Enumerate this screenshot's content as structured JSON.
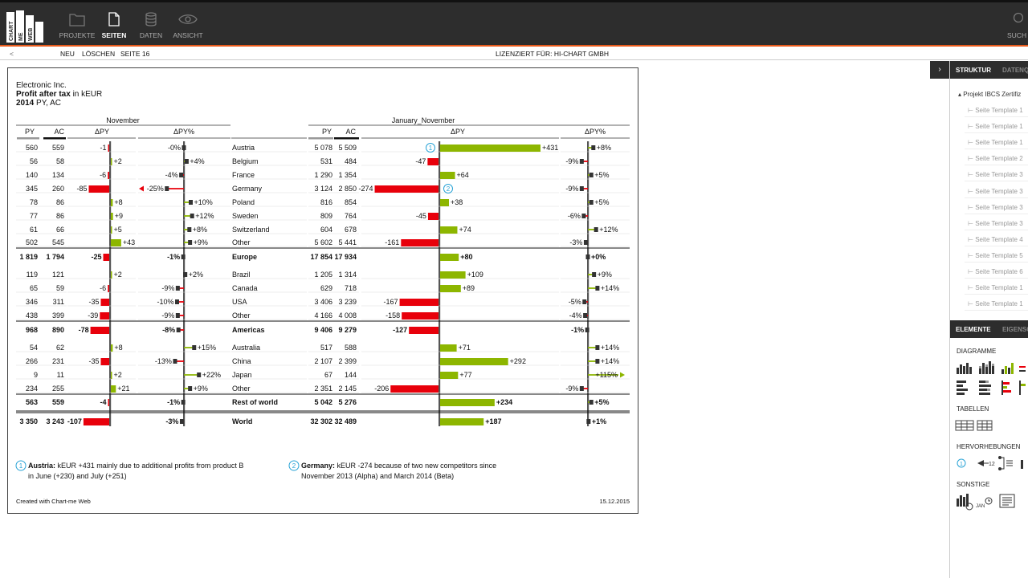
{
  "app": {
    "logo_text": [
      "CHART",
      "ME",
      "WEB"
    ]
  },
  "nav": [
    {
      "label": "PROJEKTE",
      "icon": "folder-icon"
    },
    {
      "label": "SEITEN",
      "icon": "page-icon",
      "active": true
    },
    {
      "label": "DATEN",
      "icon": "database-icon"
    },
    {
      "label": "ANSICHT",
      "icon": "eye-icon"
    }
  ],
  "search_label": "SUCH",
  "subbar": {
    "back": "<",
    "new": "NEU",
    "delete": "LÖSCHEN",
    "page": "SEITE 16",
    "license": "LIZENZIERT FÜR: HI-CHART GMBH"
  },
  "panel": {
    "tabs_top": [
      "STRUKTUR",
      "DATENQ"
    ],
    "project": "Projekt IBCS Zertifiz",
    "tree": [
      "Seite Template 1",
      "Seite Template 1",
      "Seite Template 1",
      "Seite Template 2",
      "Seite Template 3",
      "Seite Template 3",
      "Seite Template 3",
      "Seite Template 3",
      "Seite Template 4",
      "Seite Template 5",
      "Seite Template 6",
      "Seite Template 1",
      "Seite Template 1"
    ],
    "tabs_bottom": [
      "ELEMENTE",
      "EIGENSC"
    ],
    "sections": [
      "DIAGRAMME",
      "TABELLEN",
      "HERVORHEBUNGEN",
      "SONSTIGE"
    ],
    "tool_labels": {
      "highlight_num": "12",
      "other_jan": "JAN"
    }
  },
  "report": {
    "company": "Electronic Inc.",
    "title_bold": "Profit after tax",
    "title_rest": " in kEUR",
    "year": "2014",
    "scenario": " PY, AC",
    "left_header": "November",
    "right_header": "January_November",
    "col_py": "PY",
    "col_ac": "AC",
    "col_dpy": "ΔPY",
    "col_dpyp": "ΔPY%",
    "footer_left": "Created with Chart-me Web",
    "footer_right": "15.12.2015",
    "notes": [
      {
        "num": "1",
        "bold": "Austria:",
        "text": " kEUR +431 mainly due to additional profits from product B",
        "text2": "in June (+230) and July (+251)"
      },
      {
        "num": "2",
        "bold": "Germany:",
        "text": " kEUR -274 because of two new competitors since",
        "text2": "November 2013 (Alpha) and March 2014 (Beta)"
      }
    ],
    "colors": {
      "positive": "#8db600",
      "negative": "#e8000b",
      "axis": "#555555",
      "bar_dark": "#333333",
      "accent": "#e85a1b",
      "note": "#29a3d6"
    }
  },
  "chart_data": {
    "type": "table",
    "rows": [
      {
        "name": "Austria",
        "bold": false,
        "nov_py": "560",
        "nov_ac": "559",
        "nov_dpy": -1,
        "nov_dpyp": 0,
        "jn_py": "5 078",
        "jn_ac": "5 509",
        "jn_dpy": 431,
        "jn_dpyp": 8,
        "note": "1"
      },
      {
        "name": "Belgium",
        "bold": false,
        "nov_py": "56",
        "nov_ac": "58",
        "nov_dpy": 2,
        "nov_dpyp": 4,
        "jn_py": "531",
        "jn_ac": "484",
        "jn_dpy": -47,
        "jn_dpyp": -9
      },
      {
        "name": "France",
        "bold": false,
        "nov_py": "140",
        "nov_ac": "134",
        "nov_dpy": -6,
        "nov_dpyp": -4,
        "jn_py": "1 290",
        "jn_ac": "1 354",
        "jn_dpy": 64,
        "jn_dpyp": 5
      },
      {
        "name": "Germany",
        "bold": false,
        "nov_py": "345",
        "nov_ac": "260",
        "nov_dpy": -85,
        "nov_dpyp": -25,
        "jn_py": "3 124",
        "jn_ac": "2 850",
        "jn_dpy": -274,
        "jn_dpyp": -9,
        "note": "2"
      },
      {
        "name": "Poland",
        "bold": false,
        "nov_py": "78",
        "nov_ac": "86",
        "nov_dpy": 8,
        "nov_dpyp": 10,
        "jn_py": "816",
        "jn_ac": "854",
        "jn_dpy": 38,
        "jn_dpyp": 5
      },
      {
        "name": "Sweden",
        "bold": false,
        "nov_py": "77",
        "nov_ac": "86",
        "nov_dpy": 9,
        "nov_dpyp": 12,
        "jn_py": "809",
        "jn_ac": "764",
        "jn_dpy": -45,
        "jn_dpyp": -6
      },
      {
        "name": "Switzerland",
        "bold": false,
        "nov_py": "61",
        "nov_ac": "66",
        "nov_dpy": 5,
        "nov_dpyp": 8,
        "jn_py": "604",
        "jn_ac": "678",
        "jn_dpy": 74,
        "jn_dpyp": 12
      },
      {
        "name": "Other",
        "bold": false,
        "nov_py": "502",
        "nov_ac": "545",
        "nov_dpy": 43,
        "nov_dpyp": 9,
        "jn_py": "5 602",
        "jn_ac": "5 441",
        "jn_dpy": -161,
        "jn_dpyp": -3
      },
      {
        "name": "Europe",
        "bold": true,
        "nov_py": "1 819",
        "nov_ac": "1 794",
        "nov_dpy": -25,
        "nov_dpyp": -1,
        "jn_py": "17 854",
        "jn_ac": "17 934",
        "jn_dpy": 80,
        "jn_dpyp": 0
      },
      {
        "name": "Brazil",
        "bold": false,
        "nov_py": "119",
        "nov_ac": "121",
        "nov_dpy": 2,
        "nov_dpyp": 2,
        "jn_py": "1 205",
        "jn_ac": "1 314",
        "jn_dpy": 109,
        "jn_dpyp": 9
      },
      {
        "name": "Canada",
        "bold": false,
        "nov_py": "65",
        "nov_ac": "59",
        "nov_dpy": -6,
        "nov_dpyp": -9,
        "jn_py": "629",
        "jn_ac": "718",
        "jn_dpy": 89,
        "jn_dpyp": 14
      },
      {
        "name": "USA",
        "bold": false,
        "nov_py": "346",
        "nov_ac": "311",
        "nov_dpy": -35,
        "nov_dpyp": -10,
        "jn_py": "3 406",
        "jn_ac": "3 239",
        "jn_dpy": -167,
        "jn_dpyp": -5
      },
      {
        "name": "Other",
        "bold": false,
        "nov_py": "438",
        "nov_ac": "399",
        "nov_dpy": -39,
        "nov_dpyp": -9,
        "jn_py": "4 166",
        "jn_ac": "4 008",
        "jn_dpy": -158,
        "jn_dpyp": -4
      },
      {
        "name": "Americas",
        "bold": true,
        "nov_py": "968",
        "nov_ac": "890",
        "nov_dpy": -78,
        "nov_dpyp": -8,
        "jn_py": "9 406",
        "jn_ac": "9 279",
        "jn_dpy": -127,
        "jn_dpyp": -1
      },
      {
        "name": "Australia",
        "bold": false,
        "nov_py": "54",
        "nov_ac": "62",
        "nov_dpy": 8,
        "nov_dpyp": 15,
        "jn_py": "517",
        "jn_ac": "588",
        "jn_dpy": 71,
        "jn_dpyp": 14
      },
      {
        "name": "China",
        "bold": false,
        "nov_py": "266",
        "nov_ac": "231",
        "nov_dpy": -35,
        "nov_dpyp": -13,
        "jn_py": "2 107",
        "jn_ac": "2 399",
        "jn_dpy": 292,
        "jn_dpyp": 14
      },
      {
        "name": "Japan",
        "bold": false,
        "nov_py": "9",
        "nov_ac": "11",
        "nov_dpy": 2,
        "nov_dpyp": 22,
        "jn_py": "67",
        "jn_ac": "144",
        "jn_dpy": 77,
        "jn_dpyp": 115
      },
      {
        "name": "Other",
        "bold": false,
        "nov_py": "234",
        "nov_ac": "255",
        "nov_dpy": 21,
        "nov_dpyp": 9,
        "jn_py": "2 351",
        "jn_ac": "2 145",
        "jn_dpy": -206,
        "jn_dpyp": -9
      },
      {
        "name": "Rest of world",
        "bold": true,
        "nov_py": "563",
        "nov_ac": "559",
        "nov_dpy": -4,
        "nov_dpyp": -1,
        "jn_py": "5 042",
        "jn_ac": "5 276",
        "jn_dpy": 234,
        "jn_dpyp": 5
      },
      {
        "name": "World",
        "bold": true,
        "nov_py": "3 350",
        "nov_ac": "3 243",
        "nov_dpy": -107,
        "nov_dpyp": -3,
        "jn_py": "32 302",
        "jn_ac": "32 489",
        "jn_dpy": 187,
        "jn_dpyp": 1
      }
    ]
  }
}
